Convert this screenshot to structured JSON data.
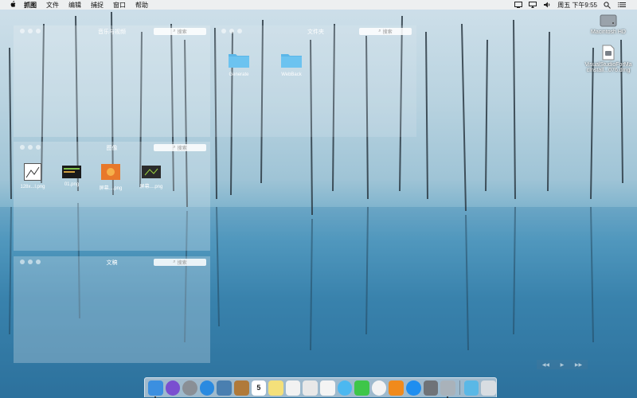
{
  "menubar": {
    "apple": "",
    "app_name": "抓图",
    "menus": [
      "文件",
      "编辑",
      "捕捉",
      "窗口",
      "帮助"
    ],
    "clock": "周五 下午9:55"
  },
  "panels": {
    "music": {
      "title": "音乐与视频",
      "search_placeholder": "搜索"
    },
    "folders": {
      "title": "文件夹",
      "search_placeholder": "搜索",
      "items": [
        "Generate",
        "WebBack"
      ]
    },
    "images": {
      "title": "图像",
      "search_placeholder": "搜索",
      "items": [
        "128x...l.png",
        "01.png",
        "屏幕....png",
        "屏幕....png"
      ]
    },
    "docs": {
      "title": "文稿",
      "search_placeholder": "搜索"
    }
  },
  "desktop": {
    "hd": "Macintosh HD",
    "dmg_line1": "VisualStudioForMa",
    "dmg_line2": "cInstall...076.dmg"
  },
  "dock": {
    "apps": [
      {
        "icon": "finder-icon",
        "color": "#3b8fe0"
      },
      {
        "icon": "siri-icon",
        "color": "#7a4fd0"
      },
      {
        "icon": "launchpad-icon",
        "color": "#8a8f96"
      },
      {
        "icon": "safari-icon",
        "color": "#2a8ae0"
      },
      {
        "icon": "preview-photo-icon",
        "color": "#4a7fb0"
      },
      {
        "icon": "notebook-icon",
        "color": "#b07a3a"
      },
      {
        "icon": "calendar-icon",
        "color": "#ffffff",
        "text": "5"
      },
      {
        "icon": "notes-icon",
        "color": "#f4e07a"
      },
      {
        "icon": "reminders-icon",
        "color": "#f2f2f2"
      },
      {
        "icon": "pages-icon",
        "color": "#e8e8e8"
      },
      {
        "icon": "photos-icon",
        "color": "#f4f4f4"
      },
      {
        "icon": "messages-icon",
        "color": "#4cb8f0"
      },
      {
        "icon": "facetime-icon",
        "color": "#3ec64a"
      },
      {
        "icon": "itunes-icon",
        "color": "#f3f3f3"
      },
      {
        "icon": "ibooks-icon",
        "color": "#f08a1c"
      },
      {
        "icon": "appstore-icon",
        "color": "#1e8ef0"
      },
      {
        "icon": "system-preferences-icon",
        "color": "#6f7378"
      },
      {
        "icon": "screenshot-app-icon",
        "color": "#a9b2ba"
      }
    ],
    "trailing": [
      {
        "icon": "downloads-folder-icon",
        "color": "#5ab8e6"
      },
      {
        "icon": "trash-icon",
        "color": "#d8dde2"
      }
    ]
  }
}
